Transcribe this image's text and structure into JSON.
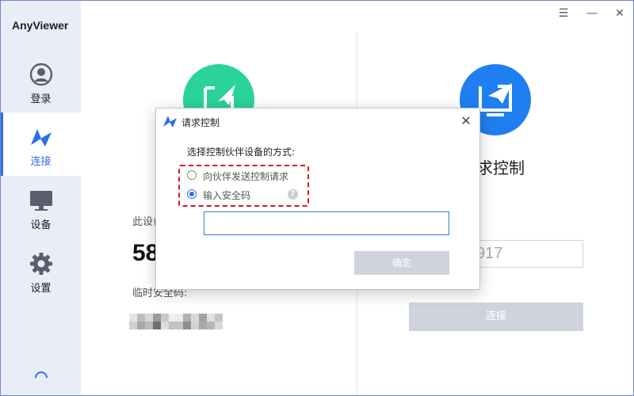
{
  "app": {
    "title": "AnyViewer"
  },
  "window_controls": {
    "menu": "☰",
    "minimize": "—",
    "close": "✕"
  },
  "sidebar": {
    "items": [
      {
        "id": "login",
        "label": "登录",
        "icon": "user-circle-icon",
        "active": false
      },
      {
        "id": "connect",
        "label": "连接",
        "icon": "connect-logo-icon",
        "active": true
      },
      {
        "id": "device",
        "label": "设备",
        "icon": "monitor-icon",
        "active": false
      },
      {
        "id": "settings",
        "label": "设置",
        "icon": "gear-icon",
        "active": false
      }
    ]
  },
  "left_panel": {
    "device_id_label": "此设备",
    "device_id_partial": "58",
    "temp_code_label": "临时安全码:"
  },
  "right_panel": {
    "title_partial": "求控制",
    "partner_id_partial": "917",
    "connect_button": "连接"
  },
  "dialog": {
    "title": "请求控制",
    "prompt": "选择控制伙伴设备的方式:",
    "options": [
      {
        "label": "向伙伴发送控制请求",
        "checked": false
      },
      {
        "label": "输入安全码",
        "checked": true
      }
    ],
    "help_icon": "?",
    "close_symbol": "✕",
    "security_code_value": "",
    "ok_button": "确定"
  },
  "colors": {
    "accent": "#2f6fe4",
    "green_icon": "#2ad39a",
    "blue_icon": "#1f7ff0",
    "highlight_dashed": "#e0141e",
    "disabled_button": "#cfd4dc",
    "sidebar_bg": "#e9edf8"
  }
}
